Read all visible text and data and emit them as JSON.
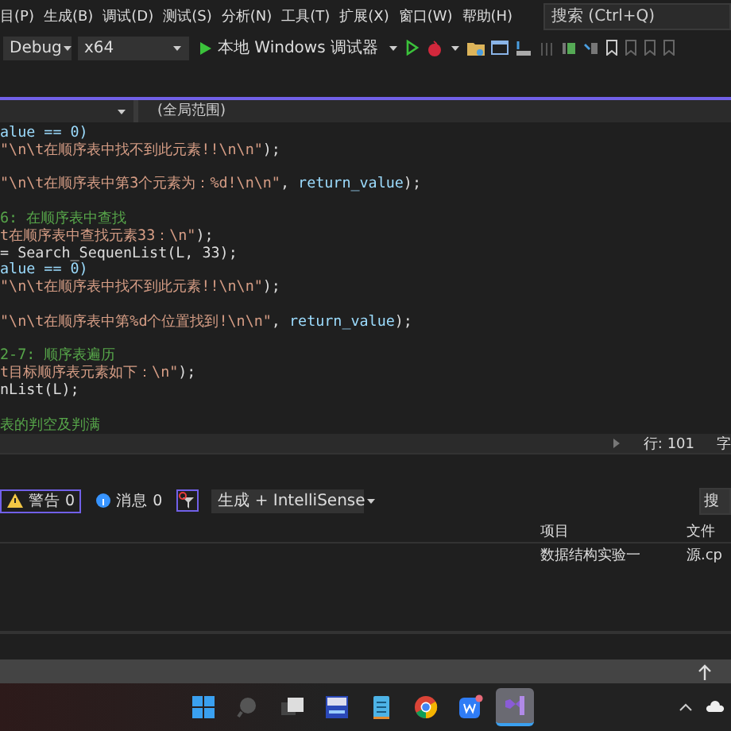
{
  "menu": [
    {
      "label": "目(P)"
    },
    {
      "label": "生成(B)"
    },
    {
      "label": "调试(D)"
    },
    {
      "label": "测试(S)"
    },
    {
      "label": "分析(N)"
    },
    {
      "label": "工具(T)"
    },
    {
      "label": "扩展(X)"
    },
    {
      "label": "窗口(W)"
    },
    {
      "label": "帮助(H)"
    }
  ],
  "search": {
    "placeholder": "搜索 (Ctrl+Q)"
  },
  "toolbar": {
    "configuration": "Debug",
    "platform": "x64",
    "run_label": "本地 Windows 调试器"
  },
  "navbar": {
    "scope": "(全局范围)"
  },
  "code_lines": [
    {
      "gap_before": false,
      "segments": [
        {
          "text": "alue == 0)",
          "kind": "ident"
        }
      ]
    },
    {
      "gap_before": false,
      "segments": [
        {
          "text": "\"\\n\\t在顺序表中找不到此元素!!\\n\\n\"",
          "kind": "string"
        },
        {
          "text": ");",
          "kind": "plain"
        }
      ]
    },
    {
      "gap_before": true,
      "segments": [
        {
          "text": "\"\\n\\t在顺序表中第3个元素为：%d!\\n\\n\"",
          "kind": "string"
        },
        {
          "text": ", ",
          "kind": "plain"
        },
        {
          "text": "return_value",
          "kind": "ident"
        },
        {
          "text": ");",
          "kind": "plain"
        }
      ]
    },
    {
      "gap_before": true,
      "segments": [
        {
          "text": "6: 在顺序表中查找",
          "kind": "comment"
        }
      ]
    },
    {
      "gap_before": false,
      "segments": [
        {
          "text": "t在顺序表中查找元素33：\\n\"",
          "kind": "string"
        },
        {
          "text": ");",
          "kind": "plain"
        }
      ]
    },
    {
      "gap_before": false,
      "segments": [
        {
          "text": "= Search_SequenList(L, 33);",
          "kind": "plain"
        }
      ]
    },
    {
      "gap_before": false,
      "segments": [
        {
          "text": "alue == 0)",
          "kind": "ident"
        }
      ]
    },
    {
      "gap_before": false,
      "segments": [
        {
          "text": "\"\\n\\t在顺序表中找不到此元素!!\\n\\n\"",
          "kind": "string"
        },
        {
          "text": ");",
          "kind": "plain"
        }
      ]
    },
    {
      "gap_before": true,
      "segments": [
        {
          "text": "\"\\n\\t在顺序表中第%d个位置找到!\\n\\n\"",
          "kind": "string"
        },
        {
          "text": ", ",
          "kind": "plain"
        },
        {
          "text": "return_value",
          "kind": "ident"
        },
        {
          "text": ");",
          "kind": "plain"
        }
      ]
    },
    {
      "gap_before": true,
      "segments": [
        {
          "text": "2-7: 顺序表遍历",
          "kind": "comment"
        }
      ]
    },
    {
      "gap_before": false,
      "segments": [
        {
          "text": "t目标顺序表元素如下：\\n\"",
          "kind": "string"
        },
        {
          "text": ");",
          "kind": "plain"
        }
      ]
    },
    {
      "gap_before": false,
      "segments": [
        {
          "text": "nList(L);",
          "kind": "plain"
        }
      ]
    },
    {
      "gap_before": true,
      "segments": [
        {
          "text": "表的判空及判满",
          "kind": "comment"
        }
      ]
    }
  ],
  "editor_status": {
    "line": "行: 101",
    "column": "字"
  },
  "error_list": {
    "filters": [
      {
        "kind": "warning",
        "label": "警告 0",
        "selected": true
      },
      {
        "kind": "info",
        "label": "消息 0",
        "selected": false
      }
    ],
    "source": "生成 + IntelliSense",
    "search_placeholder": "搜",
    "columns": [
      "项目",
      "文件"
    ],
    "rows": [
      [
        "数据结构实验一",
        "源.cp"
      ]
    ]
  },
  "taskbar": [
    {
      "kind": "start",
      "selected": false
    },
    {
      "kind": "search",
      "selected": false
    },
    {
      "kind": "taskview",
      "selected": false
    },
    {
      "kind": "devcpp",
      "selected": false
    },
    {
      "kind": "notepad",
      "selected": false
    },
    {
      "kind": "chrome",
      "selected": false
    },
    {
      "kind": "wps",
      "selected": false
    },
    {
      "kind": "vs",
      "selected": true
    }
  ]
}
